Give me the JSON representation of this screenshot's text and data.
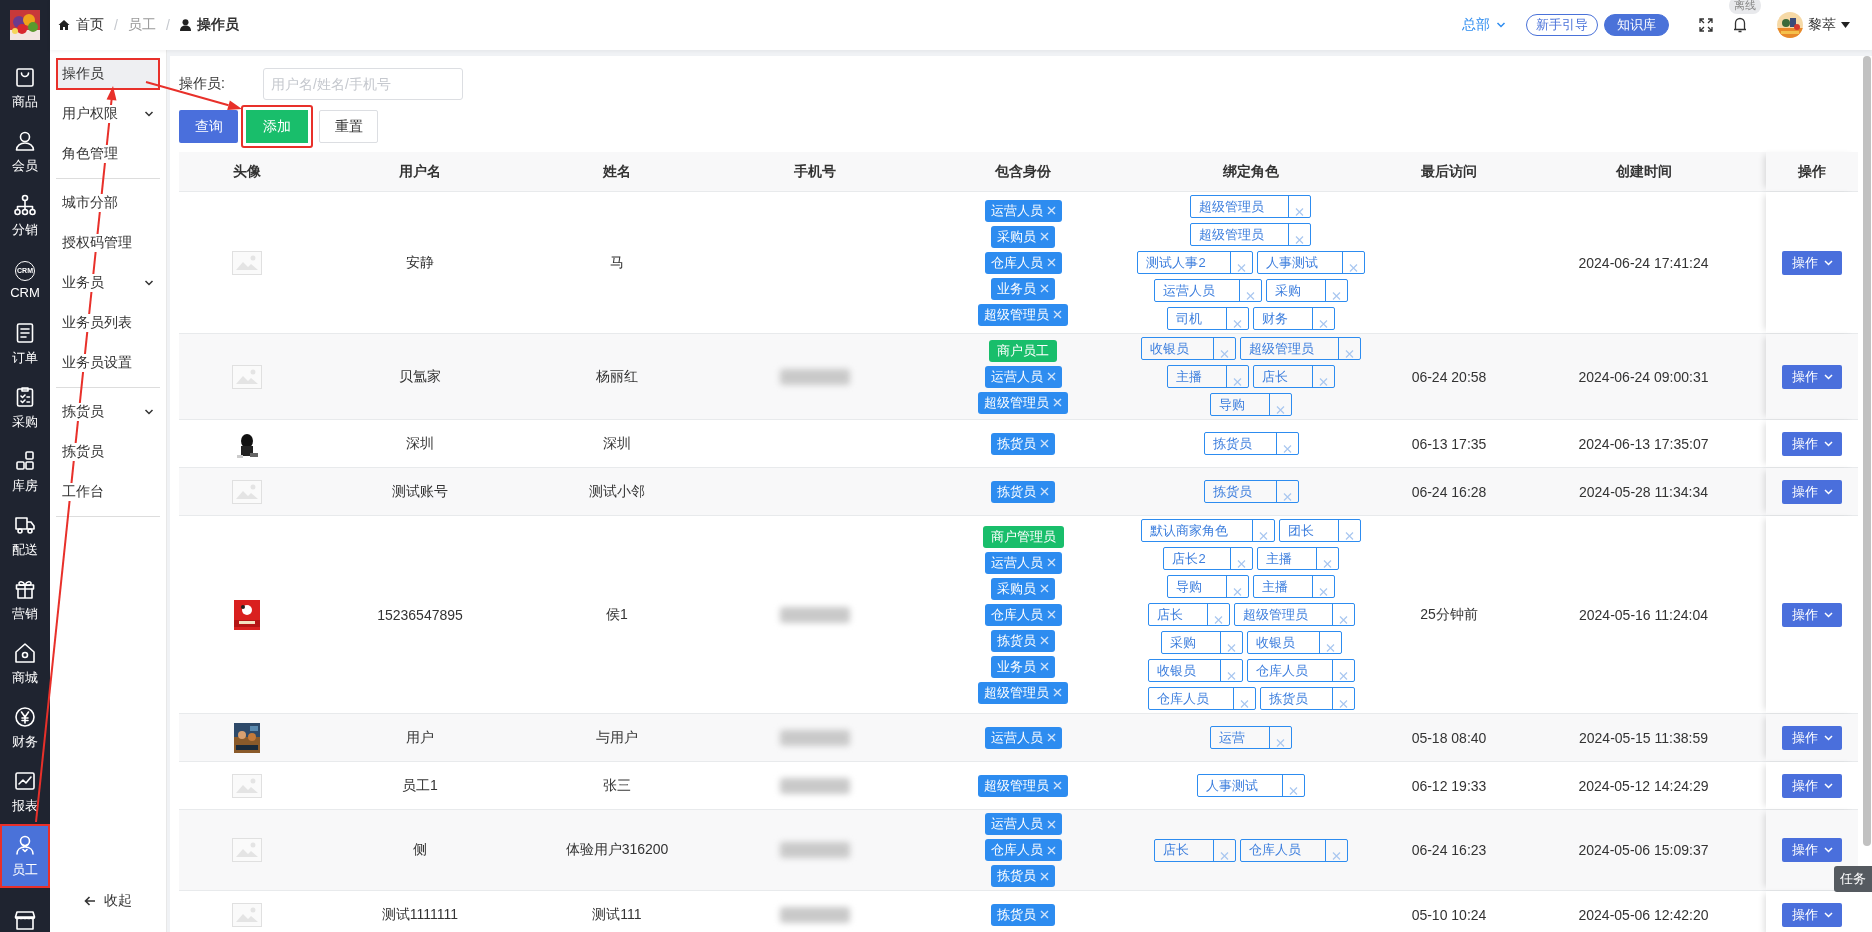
{
  "sidebar": {
    "logo": {
      "kind": "picture"
    },
    "items": [
      {
        "label": "商品",
        "selected": false,
        "highlighted": false
      },
      {
        "label": "会员",
        "selected": false,
        "highlighted": false
      },
      {
        "label": "分销",
        "selected": false,
        "highlighted": false
      },
      {
        "label": "CRM",
        "icon_text": "CRM",
        "selected": false,
        "highlighted": false
      },
      {
        "label": "订单",
        "selected": false,
        "highlighted": false
      },
      {
        "label": "采购",
        "selected": false,
        "highlighted": false
      },
      {
        "label": "库房",
        "selected": false,
        "highlighted": false
      },
      {
        "label": "配送",
        "selected": false,
        "highlighted": false
      },
      {
        "label": "营销",
        "selected": false,
        "highlighted": false
      },
      {
        "label": "商城",
        "selected": false,
        "highlighted": false
      },
      {
        "label": "财务",
        "selected": false,
        "highlighted": false
      },
      {
        "label": "报表",
        "selected": false,
        "highlighted": false
      },
      {
        "label": "员工",
        "selected": true,
        "highlighted": true
      },
      {
        "selected": false,
        "highlighted": false
      }
    ]
  },
  "submenu": {
    "sections": [
      {
        "entries": [
          {
            "label": "操作员",
            "selected": true,
            "highlighted": true
          },
          {
            "label": "用户权限",
            "expanded": true,
            "children": [
              {
                "label": "角色管理",
                "selected": false
              }
            ]
          }
        ]
      },
      {
        "entries": [
          {
            "label": "城市分部",
            "selected": false,
            "highlighted": false
          },
          {
            "label": "授权码管理",
            "selected": false,
            "highlighted": false
          },
          {
            "label": "业务员",
            "expanded": true,
            "children": [
              {
                "label": "业务员列表",
                "selected": false
              },
              {
                "label": "业务员设置",
                "selected": false
              }
            ]
          }
        ]
      },
      {
        "entries": [
          {
            "label": "拣货员",
            "expanded": true,
            "children": [
              {
                "label": "拣货员",
                "selected": false
              },
              {
                "label": "工作台",
                "selected": false
              }
            ]
          }
        ]
      }
    ],
    "collapse": "收起"
  },
  "breadcrumb": [
    {
      "label": "首页",
      "separator": "/"
    },
    {
      "label": "员工",
      "separator": "/"
    },
    {
      "label": "操作员"
    }
  ],
  "header": {
    "org": "总部",
    "guide_button": "新手引导",
    "kb_button": "知识库",
    "status_badge": "离线",
    "user_name": "黎萃"
  },
  "filter": {
    "label": "操作员:",
    "placeholder": "用户名/姓名/手机号",
    "buttons": [
      {
        "label": "查询",
        "kind": "primary",
        "highlighted": false
      },
      {
        "label": "添加",
        "kind": "success",
        "highlighted": true
      },
      {
        "label": "重置",
        "kind": "default",
        "highlighted": false
      }
    ]
  },
  "table": {
    "columns": [
      "头像",
      "用户名",
      "姓名",
      "手机号",
      "包含身份",
      "绑定角色",
      "最后访问",
      "创建时间",
      "操作"
    ],
    "rows": [
      {
        "avatar": {
          "kind": "placeholder"
        },
        "username": "安静",
        "name": "马",
        "phone_redacted": false,
        "identities": [
          {
            "label": "运营人员",
            "kind": "removable"
          },
          {
            "label": "采购员",
            "kind": "removable"
          },
          {
            "label": "仓库人员",
            "kind": "removable"
          },
          {
            "label": "业务员",
            "kind": "removable"
          },
          {
            "label": "超级管理员",
            "kind": "removable"
          }
        ],
        "role_lines": [
          [
            "超级管理员"
          ],
          [
            "超级管理员"
          ],
          [
            "测试人事2",
            "人事测试"
          ],
          [
            "运营人员",
            "采购"
          ],
          [
            "司机",
            "财务"
          ]
        ],
        "last_visit": "",
        "created": "2024-06-24 17:41:24",
        "action": "操作"
      },
      {
        "avatar": {
          "kind": "placeholder"
        },
        "username": "贝氲家",
        "name": "杨丽红",
        "phone_redacted": true,
        "identities": [
          {
            "label": "商户员工",
            "kind": "fixed"
          },
          {
            "label": "运营人员",
            "kind": "removable"
          },
          {
            "label": "超级管理员",
            "kind": "removable"
          }
        ],
        "role_lines": [
          [
            "收银员",
            "超级管理员"
          ],
          [
            "主播",
            "店长"
          ],
          [
            "导购"
          ]
        ],
        "last_visit": "06-24 20:58",
        "created": "2024-06-24 09:00:31",
        "action": "操作"
      },
      {
        "avatar": {
          "kind": "picture"
        },
        "username": "深圳",
        "name": "深圳",
        "phone_redacted": false,
        "identities": [
          {
            "label": "拣货员",
            "kind": "removable"
          }
        ],
        "role_lines": [
          [
            "拣货员"
          ]
        ],
        "last_visit": "06-13 17:35",
        "created": "2024-06-13 17:35:07",
        "action": "操作"
      },
      {
        "avatar": {
          "kind": "placeholder"
        },
        "username": "测试账号",
        "name": "测试小邻",
        "phone_redacted": false,
        "identities": [
          {
            "label": "拣货员",
            "kind": "removable"
          }
        ],
        "role_lines": [
          [
            "拣货员"
          ]
        ],
        "last_visit": "06-24 16:28",
        "created": "2024-05-28 11:34:34",
        "action": "操作"
      },
      {
        "avatar": {
          "kind": "picture"
        },
        "username": "15236547895",
        "name": "侯1",
        "phone_redacted": true,
        "identities": [
          {
            "label": "商户管理员",
            "kind": "fixed"
          },
          {
            "label": "运营人员",
            "kind": "removable"
          },
          {
            "label": "采购员",
            "kind": "removable"
          },
          {
            "label": "仓库人员",
            "kind": "removable"
          },
          {
            "label": "拣货员",
            "kind": "removable"
          },
          {
            "label": "业务员",
            "kind": "removable"
          },
          {
            "label": "超级管理员",
            "kind": "removable"
          }
        ],
        "role_lines": [
          [
            "默认商家角色",
            "团长"
          ],
          [
            "店长2",
            "主播"
          ],
          [
            "导购",
            "主播"
          ],
          [
            "店长",
            "超级管理员"
          ],
          [
            "采购",
            "收银员"
          ],
          [
            "收银员",
            "仓库人员"
          ],
          [
            "仓库人员",
            "拣货员"
          ]
        ],
        "last_visit": "25分钟前",
        "created": "2024-05-16 11:24:04",
        "action": "操作"
      },
      {
        "avatar": {
          "kind": "picture"
        },
        "username": "用户",
        "name": "与用户",
        "phone_redacted": true,
        "identities": [
          {
            "label": "运营人员",
            "kind": "removable"
          }
        ],
        "role_lines": [
          [
            "运营"
          ]
        ],
        "last_visit": "05-18 08:40",
        "created": "2024-05-15 11:38:59",
        "action": "操作"
      },
      {
        "avatar": {
          "kind": "placeholder"
        },
        "username": "员工1",
        "name": "张三",
        "phone_redacted": true,
        "identities": [
          {
            "label": "超级管理员",
            "kind": "removable"
          }
        ],
        "role_lines": [
          [
            "人事测试"
          ]
        ],
        "last_visit": "06-12 19:33",
        "created": "2024-05-12 14:24:29",
        "action": "操作"
      },
      {
        "avatar": {
          "kind": "placeholder"
        },
        "username": "侧",
        "name": "体验用户316200",
        "phone_redacted": true,
        "identities": [
          {
            "label": "运营人员",
            "kind": "removable"
          },
          {
            "label": "仓库人员",
            "kind": "removable"
          },
          {
            "label": "拣货员",
            "kind": "removable"
          }
        ],
        "role_lines": [
          [
            "店长",
            "仓库人员"
          ]
        ],
        "last_visit": "06-24 16:23",
        "created": "2024-05-06 15:09:37",
        "action": "操作"
      },
      {
        "avatar": {
          "kind": "placeholder"
        },
        "username": "测试1111111",
        "name": "测试111",
        "phone_redacted": true,
        "identities": [
          {
            "label": "拣货员",
            "kind": "removable"
          }
        ],
        "role_lines": [],
        "last_visit": "05-10 10:24",
        "created": "2024-05-06 12:42:20",
        "action": "操作"
      }
    ]
  },
  "annotation_arrows": [
    {
      "kind": "arrow"
    },
    {
      "kind": "arrow"
    }
  ],
  "task_tab": "任务"
}
